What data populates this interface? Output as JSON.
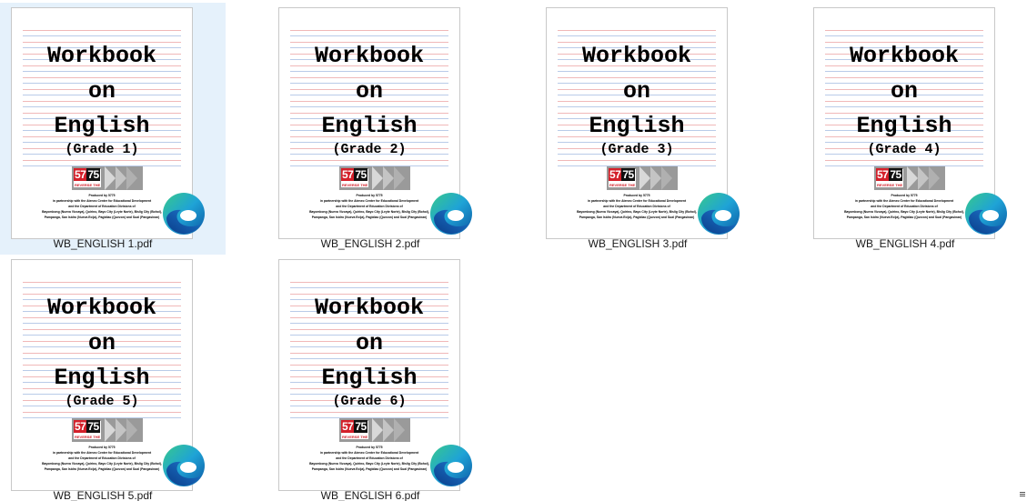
{
  "files": [
    {
      "name": "WB_ENGLISH 1.pdf",
      "selected": true,
      "cover": {
        "line1": "Workbook",
        "line2": "on",
        "line3": "English",
        "grade": "(Grade 1)"
      },
      "app_icon": "edge-icon"
    },
    {
      "name": "WB_ENGLISH 2.pdf",
      "selected": false,
      "cover": {
        "line1": "Workbook",
        "line2": "on",
        "line3": "English",
        "grade": "(Grade 2)"
      },
      "app_icon": "edge-icon"
    },
    {
      "name": "WB_ENGLISH 3.pdf",
      "selected": false,
      "cover": {
        "line1": "Workbook",
        "line2": "on",
        "line3": "English",
        "grade": "(Grade 3)"
      },
      "app_icon": "edge-icon"
    },
    {
      "name": "WB_ENGLISH 4.pdf",
      "selected": false,
      "cover": {
        "line1": "Workbook",
        "line2": "on",
        "line3": "English",
        "grade": "(Grade 4)"
      },
      "app_icon": "edge-icon"
    },
    {
      "name": "WB_ENGLISH 5.pdf",
      "selected": false,
      "cover": {
        "line1": "Workbook",
        "line2": "on",
        "line3": "English",
        "grade": "(Grade 5)"
      },
      "app_icon": "edge-icon"
    },
    {
      "name": "WB_ENGLISH 6.pdf",
      "selected": false,
      "cover": {
        "line1": "Workbook",
        "line2": "on",
        "line3": "English",
        "grade": "(Grade 6)"
      },
      "app_icon": "edge-icon"
    }
  ],
  "logo": {
    "num_red": "57",
    "num_black": "75",
    "tag": "REVERSE THE"
  },
  "credits": [
    "Produced by 5775",
    "in partnership with the Ateneo Center for Educational Development",
    "and the Department of Education Divisions of",
    "Bayombong (Nueva Vizcaya), Quirino, Bayo City (Leyte Norte), Bislig City (Bohol),",
    "Pampanga, San Isidro (Nueva Ecija), Pagbilao (Quezon) and Sual (Pangasinan)"
  ],
  "colors": {
    "selection": "#e5f1fb",
    "logo_red": "#d3202a",
    "ruled_red": "#f0b8b8",
    "ruled_blue": "#b9cbe8"
  },
  "status_icon": "view-menu-icon"
}
